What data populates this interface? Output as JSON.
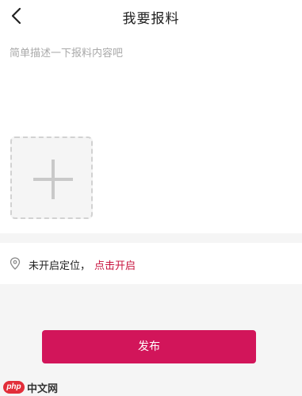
{
  "header": {
    "title": "我要报料",
    "back_icon": "chevron-left-icon"
  },
  "form": {
    "description_placeholder": "简单描述一下报料内容吧",
    "description_value": "",
    "add_photo_icon": "plus-icon"
  },
  "location": {
    "icon": "location-pin-icon",
    "status_text": "未开启定位，",
    "enable_link": "点击开启",
    "link_color": "#c8143f"
  },
  "submit": {
    "label": "发布",
    "color": "#d2155a"
  },
  "watermark": {
    "badge": "php",
    "text": "中文网"
  }
}
